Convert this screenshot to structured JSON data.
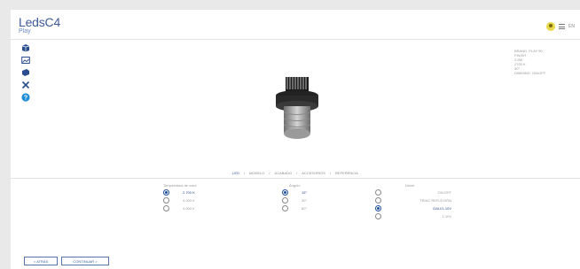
{
  "header": {
    "brand": "LedsC4",
    "sub": "Play",
    "lang": "EN"
  },
  "tools": [
    {
      "icon": "cube-view-icon"
    },
    {
      "icon": "image-icon"
    },
    {
      "icon": "layers-icon"
    },
    {
      "icon": "close-icon"
    },
    {
      "icon": "help-icon"
    }
  ],
  "specs": [
    "BRAND: PLAY 90",
    "FINISH",
    "2.5W",
    "2700 K",
    "30°",
    "DIMMING: ON/OFF"
  ],
  "steps": [
    {
      "label": "LED",
      "active": true
    },
    {
      "label": "MODELO",
      "active": false
    },
    {
      "label": "ACABADO",
      "active": false
    },
    {
      "label": "ACCESORIOS",
      "active": false
    },
    {
      "label": "REFERENCIA",
      "active": false
    }
  ],
  "options": {
    "temperature": {
      "title": "Temperatura de color",
      "items": [
        {
          "label": "2.700 K",
          "selected": true
        },
        {
          "label": "3.000 K",
          "selected": false
        },
        {
          "label": "4.000 K",
          "selected": false
        }
      ]
    },
    "angle": {
      "title": "Ángulo",
      "items": [
        {
          "label": "15°",
          "selected": true
        },
        {
          "label": "30°",
          "selected": false
        },
        {
          "label": "60°",
          "selected": false
        }
      ]
    },
    "dimming": {
      "title": "Driver",
      "items": [
        {
          "label": "ON-OFF",
          "selected": false
        },
        {
          "label": "TRIAC REFLEXIÓN",
          "selected": false
        },
        {
          "label": "DALI/1-10V",
          "selected": true
        },
        {
          "label": "1-10V",
          "selected": false
        }
      ]
    }
  },
  "buttons": {
    "back": "< ATRÁS",
    "continue": "CONTINUAR >"
  },
  "colors": {
    "accent": "#2a4c90",
    "brand": "#3d5a99",
    "user": "#e8d84a"
  }
}
